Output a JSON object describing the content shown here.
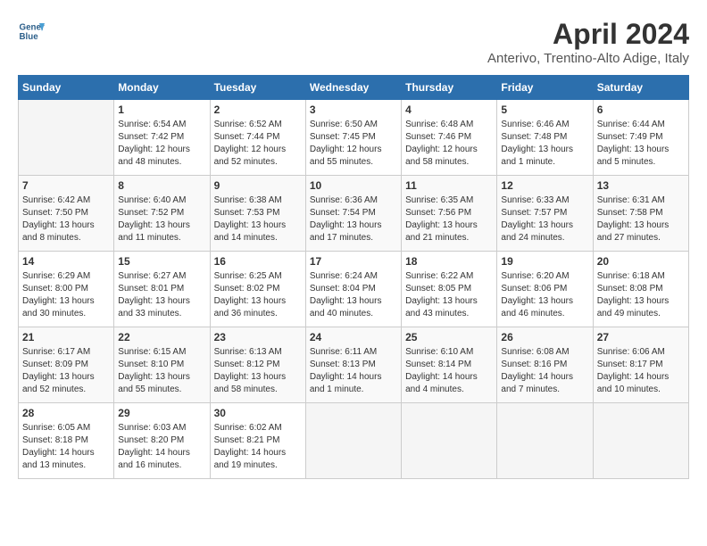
{
  "header": {
    "logo_line1": "General",
    "logo_line2": "Blue",
    "title": "April 2024",
    "subtitle": "Anterivo, Trentino-Alto Adige, Italy"
  },
  "columns": [
    "Sunday",
    "Monday",
    "Tuesday",
    "Wednesday",
    "Thursday",
    "Friday",
    "Saturday"
  ],
  "weeks": [
    [
      {
        "day": "",
        "info": ""
      },
      {
        "day": "1",
        "info": "Sunrise: 6:54 AM\nSunset: 7:42 PM\nDaylight: 12 hours\nand 48 minutes."
      },
      {
        "day": "2",
        "info": "Sunrise: 6:52 AM\nSunset: 7:44 PM\nDaylight: 12 hours\nand 52 minutes."
      },
      {
        "day": "3",
        "info": "Sunrise: 6:50 AM\nSunset: 7:45 PM\nDaylight: 12 hours\nand 55 minutes."
      },
      {
        "day": "4",
        "info": "Sunrise: 6:48 AM\nSunset: 7:46 PM\nDaylight: 12 hours\nand 58 minutes."
      },
      {
        "day": "5",
        "info": "Sunrise: 6:46 AM\nSunset: 7:48 PM\nDaylight: 13 hours\nand 1 minute."
      },
      {
        "day": "6",
        "info": "Sunrise: 6:44 AM\nSunset: 7:49 PM\nDaylight: 13 hours\nand 5 minutes."
      }
    ],
    [
      {
        "day": "7",
        "info": "Sunrise: 6:42 AM\nSunset: 7:50 PM\nDaylight: 13 hours\nand 8 minutes."
      },
      {
        "day": "8",
        "info": "Sunrise: 6:40 AM\nSunset: 7:52 PM\nDaylight: 13 hours\nand 11 minutes."
      },
      {
        "day": "9",
        "info": "Sunrise: 6:38 AM\nSunset: 7:53 PM\nDaylight: 13 hours\nand 14 minutes."
      },
      {
        "day": "10",
        "info": "Sunrise: 6:36 AM\nSunset: 7:54 PM\nDaylight: 13 hours\nand 17 minutes."
      },
      {
        "day": "11",
        "info": "Sunrise: 6:35 AM\nSunset: 7:56 PM\nDaylight: 13 hours\nand 21 minutes."
      },
      {
        "day": "12",
        "info": "Sunrise: 6:33 AM\nSunset: 7:57 PM\nDaylight: 13 hours\nand 24 minutes."
      },
      {
        "day": "13",
        "info": "Sunrise: 6:31 AM\nSunset: 7:58 PM\nDaylight: 13 hours\nand 27 minutes."
      }
    ],
    [
      {
        "day": "14",
        "info": "Sunrise: 6:29 AM\nSunset: 8:00 PM\nDaylight: 13 hours\nand 30 minutes."
      },
      {
        "day": "15",
        "info": "Sunrise: 6:27 AM\nSunset: 8:01 PM\nDaylight: 13 hours\nand 33 minutes."
      },
      {
        "day": "16",
        "info": "Sunrise: 6:25 AM\nSunset: 8:02 PM\nDaylight: 13 hours\nand 36 minutes."
      },
      {
        "day": "17",
        "info": "Sunrise: 6:24 AM\nSunset: 8:04 PM\nDaylight: 13 hours\nand 40 minutes."
      },
      {
        "day": "18",
        "info": "Sunrise: 6:22 AM\nSunset: 8:05 PM\nDaylight: 13 hours\nand 43 minutes."
      },
      {
        "day": "19",
        "info": "Sunrise: 6:20 AM\nSunset: 8:06 PM\nDaylight: 13 hours\nand 46 minutes."
      },
      {
        "day": "20",
        "info": "Sunrise: 6:18 AM\nSunset: 8:08 PM\nDaylight: 13 hours\nand 49 minutes."
      }
    ],
    [
      {
        "day": "21",
        "info": "Sunrise: 6:17 AM\nSunset: 8:09 PM\nDaylight: 13 hours\nand 52 minutes."
      },
      {
        "day": "22",
        "info": "Sunrise: 6:15 AM\nSunset: 8:10 PM\nDaylight: 13 hours\nand 55 minutes."
      },
      {
        "day": "23",
        "info": "Sunrise: 6:13 AM\nSunset: 8:12 PM\nDaylight: 13 hours\nand 58 minutes."
      },
      {
        "day": "24",
        "info": "Sunrise: 6:11 AM\nSunset: 8:13 PM\nDaylight: 14 hours\nand 1 minute."
      },
      {
        "day": "25",
        "info": "Sunrise: 6:10 AM\nSunset: 8:14 PM\nDaylight: 14 hours\nand 4 minutes."
      },
      {
        "day": "26",
        "info": "Sunrise: 6:08 AM\nSunset: 8:16 PM\nDaylight: 14 hours\nand 7 minutes."
      },
      {
        "day": "27",
        "info": "Sunrise: 6:06 AM\nSunset: 8:17 PM\nDaylight: 14 hours\nand 10 minutes."
      }
    ],
    [
      {
        "day": "28",
        "info": "Sunrise: 6:05 AM\nSunset: 8:18 PM\nDaylight: 14 hours\nand 13 minutes."
      },
      {
        "day": "29",
        "info": "Sunrise: 6:03 AM\nSunset: 8:20 PM\nDaylight: 14 hours\nand 16 minutes."
      },
      {
        "day": "30",
        "info": "Sunrise: 6:02 AM\nSunset: 8:21 PM\nDaylight: 14 hours\nand 19 minutes."
      },
      {
        "day": "",
        "info": ""
      },
      {
        "day": "",
        "info": ""
      },
      {
        "day": "",
        "info": ""
      },
      {
        "day": "",
        "info": ""
      }
    ]
  ]
}
